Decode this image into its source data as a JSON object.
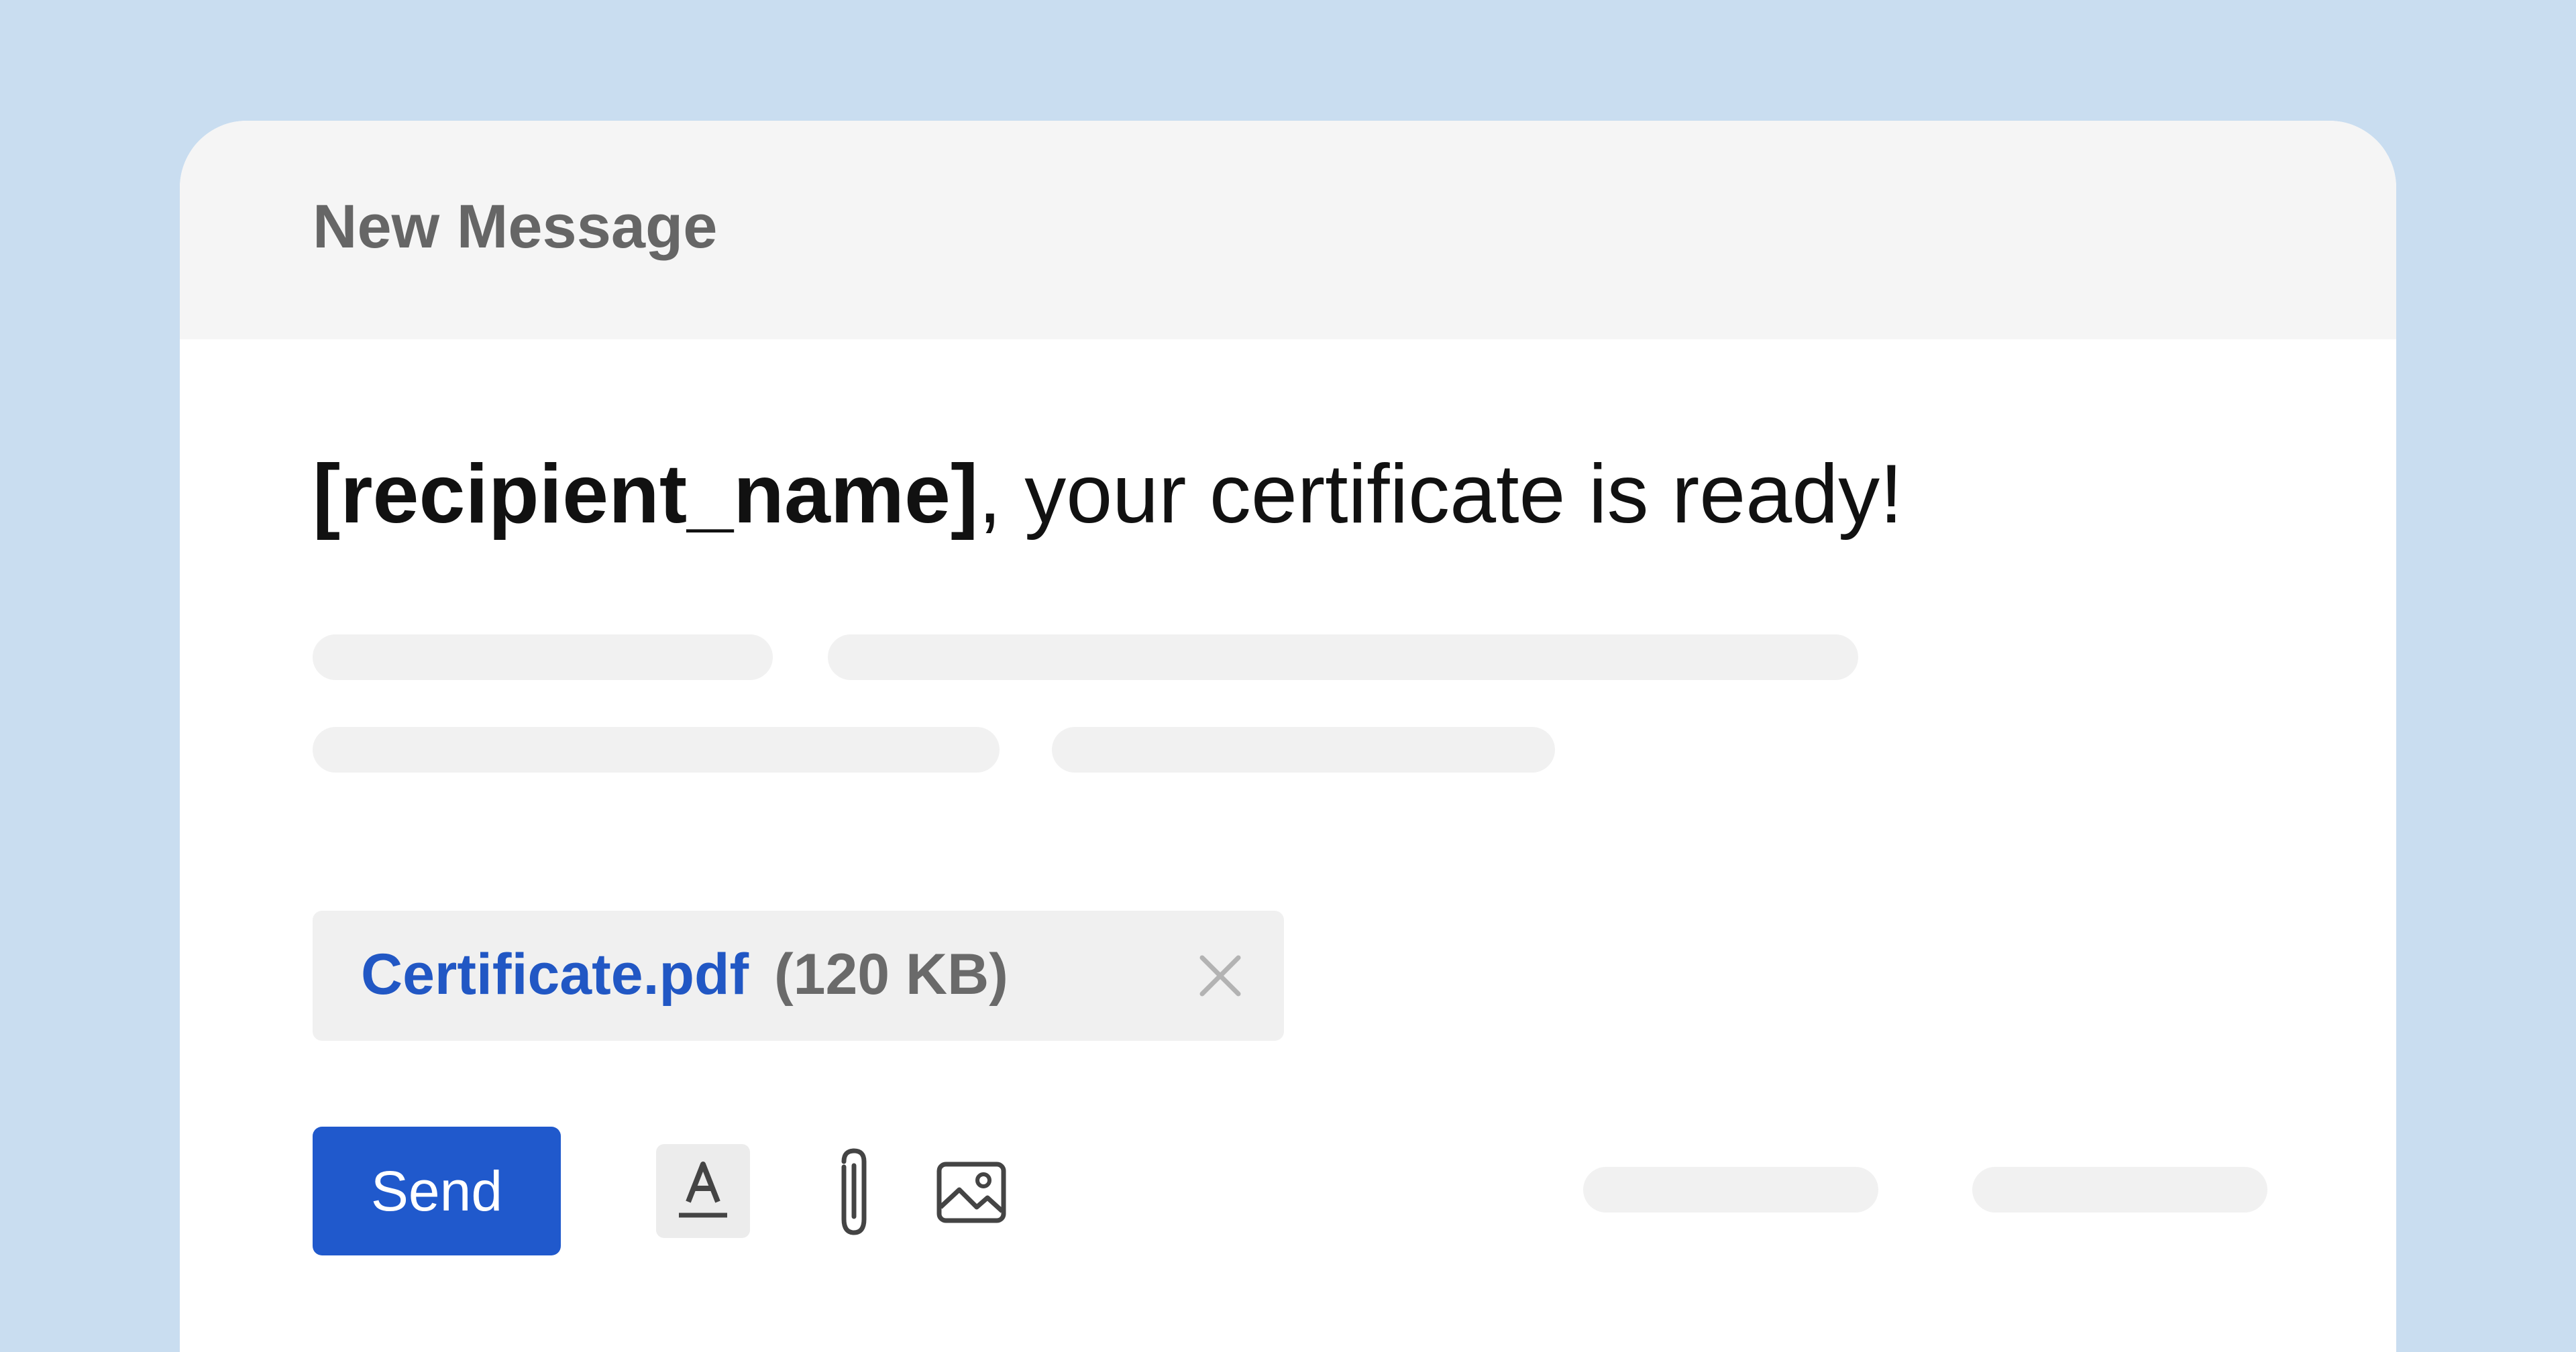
{
  "window": {
    "title": "New Message"
  },
  "message": {
    "subject_placeholder": "[recipient_name]",
    "subject_rest": ", your certificate is ready!"
  },
  "attachment": {
    "file_name": "Certificate.pdf",
    "file_size": "(120 KB)",
    "remove_icon": "close-icon"
  },
  "toolbar": {
    "send_label": "Send",
    "format_icon": "text-format-icon",
    "attach_icon": "paperclip-icon",
    "image_icon": "image-icon"
  },
  "colors": {
    "background": "#c9ddf0",
    "header": "#f5f5f5",
    "accent": "#2059cc",
    "link": "#2157c4",
    "placeholder_bar": "#f1f1f1"
  }
}
